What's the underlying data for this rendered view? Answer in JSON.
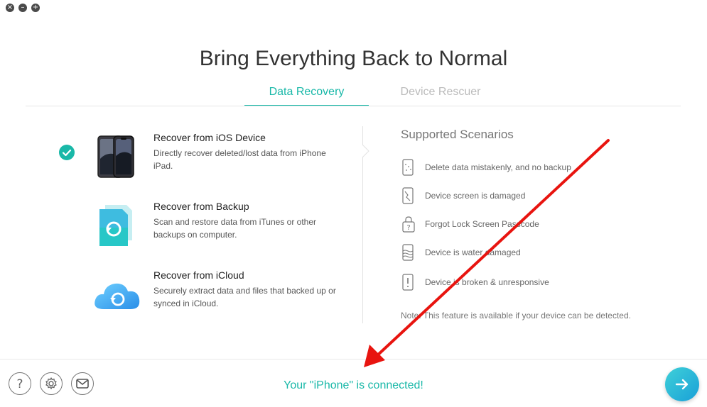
{
  "window": {
    "close": "×",
    "minimize": "–",
    "maximize": "+"
  },
  "title": "Bring Everything Back to Normal",
  "tabs": [
    {
      "label": "Data Recovery",
      "active": true
    },
    {
      "label": "Device Rescuer",
      "active": false
    }
  ],
  "options": [
    {
      "title": "Recover from iOS Device",
      "desc": "Directly recover deleted/lost data from iPhone iPad.",
      "selected": true,
      "icon": "iphone-devices-icon"
    },
    {
      "title": "Recover from Backup",
      "desc": "Scan and restore data from iTunes or other backups on computer.",
      "selected": false,
      "icon": "backup-file-icon"
    },
    {
      "title": "Recover from iCloud",
      "desc": "Securely extract data and files that backed up or synced in iCloud.",
      "selected": false,
      "icon": "icloud-icon"
    }
  ],
  "scenarios": {
    "title": "Supported Scenarios",
    "items": [
      {
        "text": "Delete data mistakenly, and no backup",
        "icon": "deleted-phone-icon"
      },
      {
        "text": "Device screen is damaged",
        "icon": "cracked-screen-icon"
      },
      {
        "text": "Forgot Lock Screen Passcode",
        "icon": "lock-question-icon"
      },
      {
        "text": "Device is water damaged",
        "icon": "water-damage-icon"
      },
      {
        "text": "Device is broken & unresponsive",
        "icon": "broken-device-icon"
      }
    ],
    "note": "Note: This feature is available if your device can be detected."
  },
  "footer": {
    "status": "Your \"iPhone\" is connected!",
    "buttons": [
      "help-icon",
      "settings-icon",
      "mail-icon"
    ],
    "next": "arrow-right-icon"
  },
  "colors": {
    "accent": "#19b8a8",
    "annotation_arrow": "#e8140f"
  }
}
